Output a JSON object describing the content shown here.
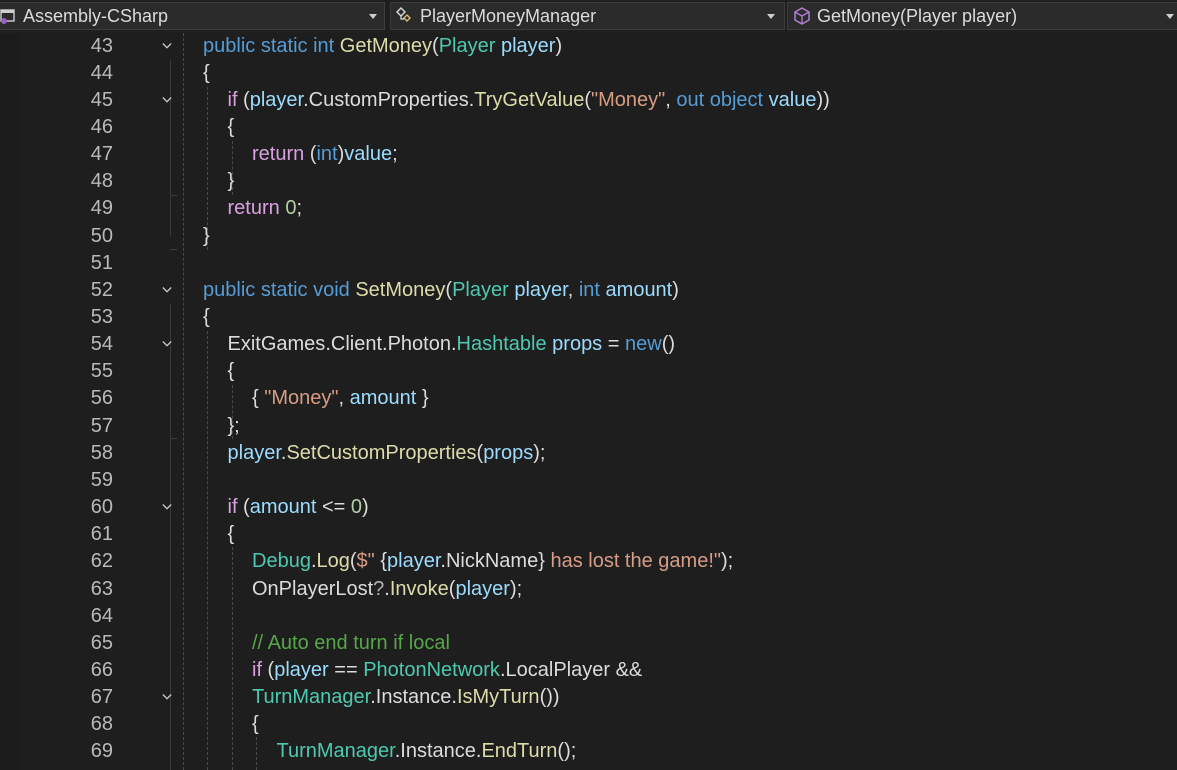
{
  "navigation_bar": {
    "project": "Assembly-CSharp",
    "class": "PlayerMoneyManager",
    "member": "GetMoney(Player player)"
  },
  "icons": {
    "project_icon": "csharp-project-icon",
    "class_icon": "class-icon",
    "member_icon": "method-cube-icon",
    "dropdown": "chevron-down-icon",
    "fold": "collapse-chevron-icon"
  },
  "colors": {
    "keyword": "#569cd6",
    "control": "#d8a0df",
    "type": "#4ec9b0",
    "method": "#dcdcaa",
    "identifier": "#9cdcfe",
    "string": "#d69d85",
    "number": "#b5cea8",
    "comment": "#57a64a",
    "plain": "#dcdcdc",
    "background": "#1e1e1e"
  },
  "lines": [
    {
      "n": "43",
      "fold": true,
      "indent": 0,
      "tokens": [
        [
          "kw",
          "public"
        ],
        [
          "p",
          " "
        ],
        [
          "kw",
          "static"
        ],
        [
          "p",
          " "
        ],
        [
          "kw",
          "int"
        ],
        [
          "p",
          " "
        ],
        [
          "fn",
          "GetMoney"
        ],
        [
          "p",
          "("
        ],
        [
          "ty",
          "Player"
        ],
        [
          "p",
          " "
        ],
        [
          "id",
          "player"
        ],
        [
          "p",
          ")"
        ]
      ]
    },
    {
      "n": "44",
      "fold": false,
      "indent": 0,
      "tokens": [
        [
          "p",
          "{"
        ]
      ]
    },
    {
      "n": "45",
      "fold": true,
      "indent": 1,
      "tokens": [
        [
          "ctl",
          "if"
        ],
        [
          "p",
          " ("
        ],
        [
          "id",
          "player"
        ],
        [
          "p",
          "."
        ],
        [
          "p",
          "CustomProperties"
        ],
        [
          "p",
          "."
        ],
        [
          "fn",
          "TryGetValue"
        ],
        [
          "p",
          "("
        ],
        [
          "str",
          "\"Money\""
        ],
        [
          "p",
          ", "
        ],
        [
          "kw",
          "out"
        ],
        [
          "p",
          " "
        ],
        [
          "kw",
          "object"
        ],
        [
          "p",
          " "
        ],
        [
          "id",
          "value"
        ],
        [
          "p",
          "))"
        ]
      ]
    },
    {
      "n": "46",
      "fold": false,
      "indent": 1,
      "tokens": [
        [
          "p",
          "{"
        ]
      ]
    },
    {
      "n": "47",
      "fold": false,
      "indent": 2,
      "tokens": [
        [
          "ctl",
          "return"
        ],
        [
          "p",
          " ("
        ],
        [
          "kw",
          "int"
        ],
        [
          "p",
          ")"
        ],
        [
          "id",
          "value"
        ],
        [
          "p",
          ";"
        ]
      ]
    },
    {
      "n": "48",
      "fold": false,
      "indent": 1,
      "tokens": [
        [
          "p",
          "}"
        ]
      ]
    },
    {
      "n": "49",
      "fold": false,
      "indent": 1,
      "tokens": [
        [
          "ctl",
          "return"
        ],
        [
          "p",
          " "
        ],
        [
          "num",
          "0"
        ],
        [
          "p",
          ";"
        ]
      ]
    },
    {
      "n": "50",
      "fold": false,
      "indent": 0,
      "tokens": [
        [
          "p",
          "}"
        ]
      ]
    },
    {
      "n": "51",
      "fold": false,
      "indent": 0,
      "tokens": []
    },
    {
      "n": "52",
      "fold": true,
      "indent": 0,
      "tokens": [
        [
          "kw",
          "public"
        ],
        [
          "p",
          " "
        ],
        [
          "kw",
          "static"
        ],
        [
          "p",
          " "
        ],
        [
          "kw",
          "void"
        ],
        [
          "p",
          " "
        ],
        [
          "fn",
          "SetMoney"
        ],
        [
          "p",
          "("
        ],
        [
          "ty",
          "Player"
        ],
        [
          "p",
          " "
        ],
        [
          "id",
          "player"
        ],
        [
          "p",
          ", "
        ],
        [
          "kw",
          "int"
        ],
        [
          "p",
          " "
        ],
        [
          "id",
          "amount"
        ],
        [
          "p",
          ")"
        ]
      ]
    },
    {
      "n": "53",
      "fold": false,
      "indent": 0,
      "tokens": [
        [
          "p",
          "{"
        ]
      ]
    },
    {
      "n": "54",
      "fold": true,
      "indent": 1,
      "tokens": [
        [
          "p",
          "ExitGames"
        ],
        [
          "p",
          "."
        ],
        [
          "p",
          "Client"
        ],
        [
          "p",
          "."
        ],
        [
          "p",
          "Photon"
        ],
        [
          "p",
          "."
        ],
        [
          "ty",
          "Hashtable"
        ],
        [
          "p",
          " "
        ],
        [
          "id",
          "props"
        ],
        [
          "p",
          " = "
        ],
        [
          "kw",
          "new"
        ],
        [
          "p",
          "()"
        ]
      ]
    },
    {
      "n": "55",
      "fold": false,
      "indent": 1,
      "tokens": [
        [
          "p",
          "{"
        ]
      ]
    },
    {
      "n": "56",
      "fold": false,
      "indent": 2,
      "tokens": [
        [
          "p",
          "{ "
        ],
        [
          "str",
          "\"Money\""
        ],
        [
          "p",
          ", "
        ],
        [
          "id",
          "amount"
        ],
        [
          "p",
          " }"
        ]
      ]
    },
    {
      "n": "57",
      "fold": false,
      "indent": 1,
      "tokens": [
        [
          "p",
          "};"
        ]
      ]
    },
    {
      "n": "58",
      "fold": false,
      "indent": 1,
      "tokens": [
        [
          "id",
          "player"
        ],
        [
          "p",
          "."
        ],
        [
          "fn",
          "SetCustomProperties"
        ],
        [
          "p",
          "("
        ],
        [
          "id",
          "props"
        ],
        [
          "p",
          ");"
        ]
      ]
    },
    {
      "n": "59",
      "fold": false,
      "indent": 1,
      "tokens": []
    },
    {
      "n": "60",
      "fold": true,
      "indent": 1,
      "tokens": [
        [
          "ctl",
          "if"
        ],
        [
          "p",
          " ("
        ],
        [
          "id",
          "amount"
        ],
        [
          "p",
          " <= "
        ],
        [
          "num",
          "0"
        ],
        [
          "p",
          ")"
        ]
      ]
    },
    {
      "n": "61",
      "fold": false,
      "indent": 1,
      "tokens": [
        [
          "p",
          "{"
        ]
      ]
    },
    {
      "n": "62",
      "fold": false,
      "indent": 2,
      "tokens": [
        [
          "ty",
          "Debug"
        ],
        [
          "p",
          "."
        ],
        [
          "fn",
          "Log"
        ],
        [
          "p",
          "("
        ],
        [
          "str",
          "$\" "
        ],
        [
          "p",
          "{"
        ],
        [
          "id",
          "player"
        ],
        [
          "p",
          "."
        ],
        [
          "p",
          "NickName"
        ],
        [
          "p",
          "}"
        ],
        [
          "str",
          " has lost the game!\""
        ],
        [
          "p",
          ");"
        ]
      ]
    },
    {
      "n": "63",
      "fold": false,
      "indent": 2,
      "tokens": [
        [
          "p",
          "OnPlayerLost"
        ],
        [
          "op",
          "?"
        ],
        [
          "p",
          "."
        ],
        [
          "fn",
          "Invoke"
        ],
        [
          "p",
          "("
        ],
        [
          "id",
          "player"
        ],
        [
          "p",
          ");"
        ]
      ]
    },
    {
      "n": "64",
      "fold": false,
      "indent": 2,
      "tokens": []
    },
    {
      "n": "65",
      "fold": false,
      "indent": 2,
      "tokens": [
        [
          "cm",
          "// Auto end turn if local"
        ]
      ]
    },
    {
      "n": "66",
      "fold": false,
      "indent": 2,
      "tokens": [
        [
          "ctl",
          "if"
        ],
        [
          "p",
          " ("
        ],
        [
          "id",
          "player"
        ],
        [
          "p",
          " == "
        ],
        [
          "ty",
          "PhotonNetwork"
        ],
        [
          "p",
          "."
        ],
        [
          "p",
          "LocalPlayer"
        ],
        [
          "p",
          " &&"
        ]
      ]
    },
    {
      "n": "67",
      "fold": true,
      "indent": 2,
      "tokens": [
        [
          "ty",
          "TurnManager"
        ],
        [
          "p",
          "."
        ],
        [
          "p",
          "Instance"
        ],
        [
          "p",
          "."
        ],
        [
          "fn",
          "IsMyTurn"
        ],
        [
          "p",
          "())"
        ]
      ]
    },
    {
      "n": "68",
      "fold": false,
      "indent": 2,
      "tokens": [
        [
          "p",
          "{"
        ]
      ]
    },
    {
      "n": "69",
      "fold": false,
      "indent": 3,
      "tokens": [
        [
          "ty",
          "TurnManager"
        ],
        [
          "p",
          "."
        ],
        [
          "p",
          "Instance"
        ],
        [
          "p",
          "."
        ],
        [
          "fn",
          "EndTurn"
        ],
        [
          "p",
          "();"
        ]
      ]
    }
  ]
}
